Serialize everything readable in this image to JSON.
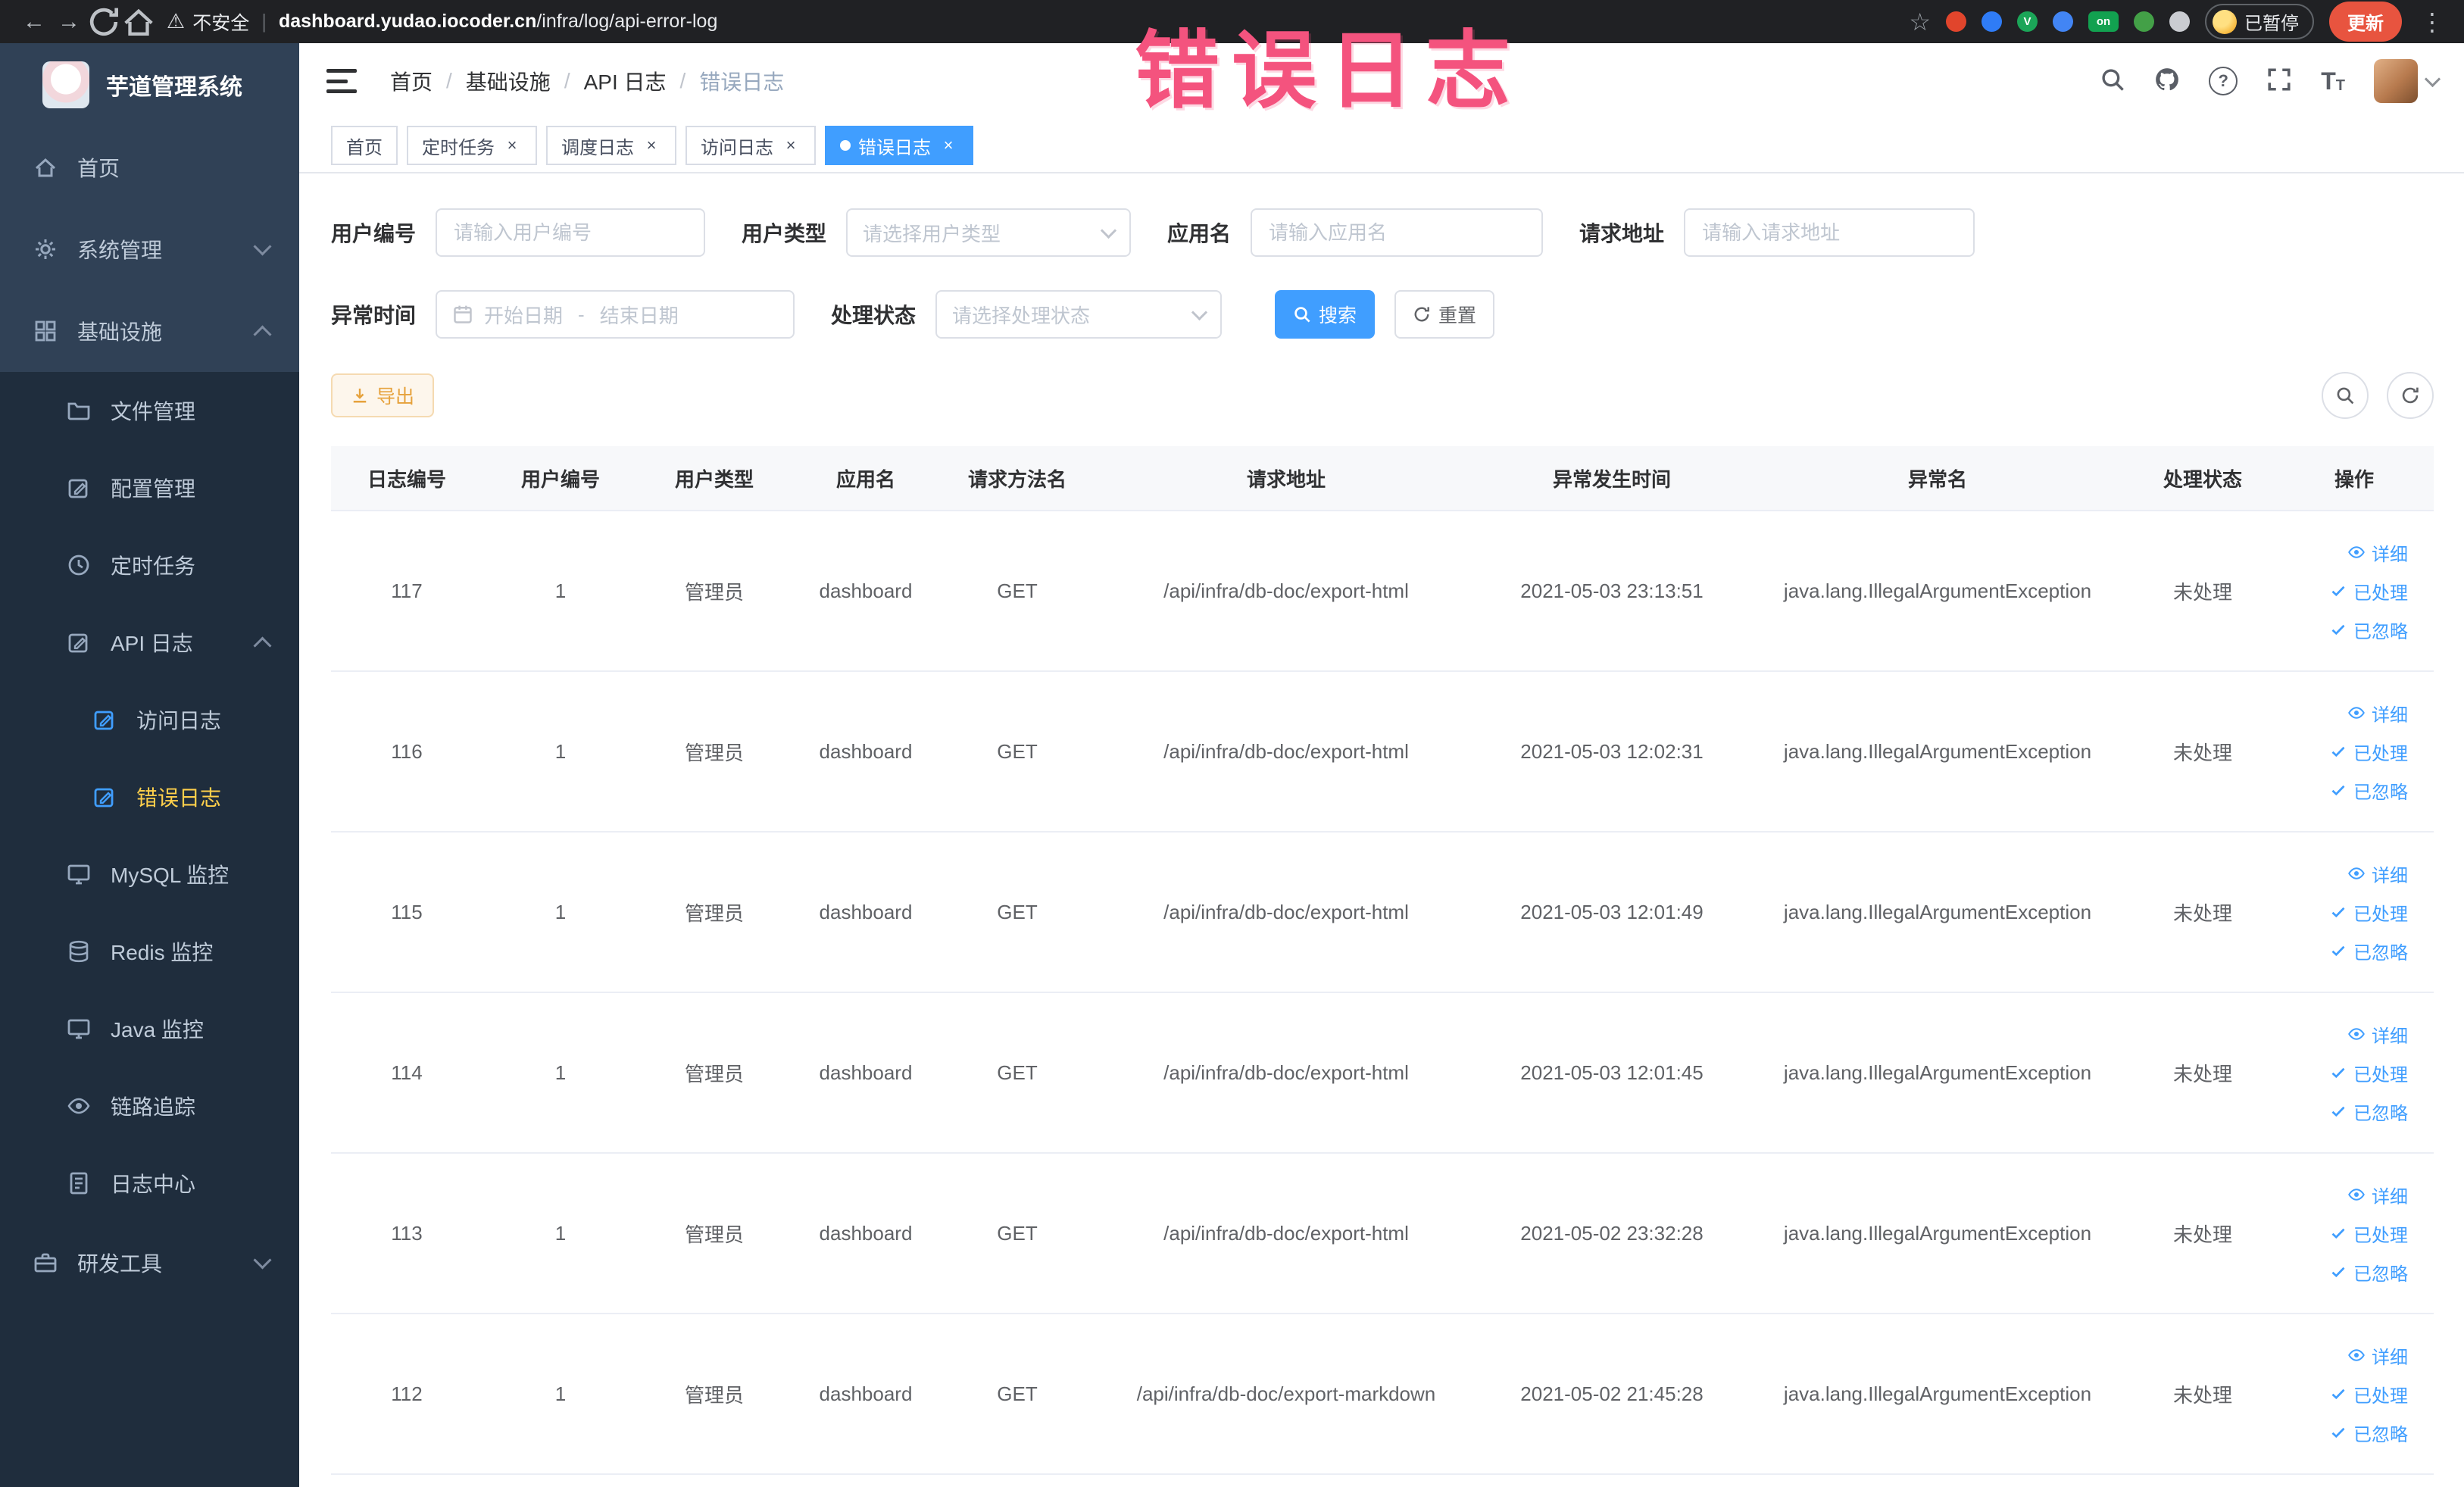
{
  "watermark": {
    "text": "错误日志"
  },
  "colors": {
    "primary": "#409eff",
    "sidebar_bg": "#304156",
    "sidebar_sub_bg": "#1f2d3d",
    "sidebar_active_text": "#ffd04b",
    "watermark_text": "#f4537e",
    "warning_button_text": "#e6a23c",
    "update_button_bg": "#e8543f"
  },
  "browser": {
    "security_label": "不安全",
    "url_domain": "dashboard.yudao.iocoder.cn",
    "url_path": "/infra/log/api-error-log",
    "paused_label": "已暂停",
    "update_label": "更新",
    "extensions": [
      {
        "name": "extension-red-dot",
        "color": "#e1452c",
        "label": ""
      },
      {
        "name": "extension-blue-dot",
        "color": "#2f7cf6",
        "label": ""
      },
      {
        "name": "extension-green-v",
        "color": "#1ba558",
        "label": "V"
      },
      {
        "name": "extension-blue-grid",
        "color": "#4285f4",
        "label": ""
      },
      {
        "name": "extension-on-badge",
        "color": "#12a150",
        "label": "on"
      },
      {
        "name": "extension-green-leaf",
        "color": "#43a047",
        "label": ""
      },
      {
        "name": "extension-gray-paw",
        "color": "#caccd1",
        "label": ""
      }
    ]
  },
  "sidebar": {
    "logo_title": "芋道管理系统",
    "home_label": "首页",
    "system_label": "系统管理",
    "infra_label": "基础设施",
    "file_label": "文件管理",
    "config_label": "配置管理",
    "job_label": "定时任务",
    "api_log_label": "API 日志",
    "access_log_label": "访问日志",
    "error_log_label": "错误日志",
    "mysql_label": "MySQL 监控",
    "redis_label": "Redis 监控",
    "java_label": "Java 监控",
    "trace_label": "链路追踪",
    "log_center_label": "日志中心",
    "dev_label": "研发工具"
  },
  "header": {
    "breadcrumb": [
      "首页",
      "基础设施",
      "API 日志",
      "错误日志"
    ]
  },
  "tabs": [
    {
      "label": "首页",
      "closable": false,
      "active": false
    },
    {
      "label": "定时任务",
      "closable": true,
      "active": false
    },
    {
      "label": "调度日志",
      "closable": true,
      "active": false
    },
    {
      "label": "访问日志",
      "closable": true,
      "active": false
    },
    {
      "label": "错误日志",
      "closable": true,
      "active": true
    }
  ],
  "filters": {
    "user_id_label": "用户编号",
    "user_id_placeholder": "请输入用户编号",
    "user_type_label": "用户类型",
    "user_type_placeholder": "请选择用户类型",
    "app_name_label": "应用名",
    "app_name_placeholder": "请输入应用名",
    "request_url_label": "请求地址",
    "request_url_placeholder": "请输入请求地址",
    "time_label": "异常时间",
    "time_start_placeholder": "开始日期",
    "time_separator": "-",
    "time_end_placeholder": "结束日期",
    "status_label": "处理状态",
    "status_placeholder": "请选择处理状态",
    "search_label": "搜索",
    "reset_label": "重置"
  },
  "toolbar": {
    "export_label": "导出"
  },
  "table": {
    "columns": [
      "日志编号",
      "用户编号",
      "用户类型",
      "应用名",
      "请求方法名",
      "请求地址",
      "异常发生时间",
      "异常名",
      "处理状态",
      "操作"
    ],
    "action_labels": {
      "detail": "详细",
      "processed": "已处理",
      "ignored": "已忽略"
    },
    "rows": [
      {
        "log_id": "117",
        "user_id": "1",
        "user_type": "管理员",
        "app_name": "dashboard",
        "method": "GET",
        "request_url": "/api/infra/db-doc/export-html",
        "time": "2021-05-03 23:13:51",
        "exception_name": "java.lang.IllegalArgumentException",
        "status": "未处理"
      },
      {
        "log_id": "116",
        "user_id": "1",
        "user_type": "管理员",
        "app_name": "dashboard",
        "method": "GET",
        "request_url": "/api/infra/db-doc/export-html",
        "time": "2021-05-03 12:02:31",
        "exception_name": "java.lang.IllegalArgumentException",
        "status": "未处理"
      },
      {
        "log_id": "115",
        "user_id": "1",
        "user_type": "管理员",
        "app_name": "dashboard",
        "method": "GET",
        "request_url": "/api/infra/db-doc/export-html",
        "time": "2021-05-03 12:01:49",
        "exception_name": "java.lang.IllegalArgumentException",
        "status": "未处理"
      },
      {
        "log_id": "114",
        "user_id": "1",
        "user_type": "管理员",
        "app_name": "dashboard",
        "method": "GET",
        "request_url": "/api/infra/db-doc/export-html",
        "time": "2021-05-03 12:01:45",
        "exception_name": "java.lang.IllegalArgumentException",
        "status": "未处理"
      },
      {
        "log_id": "113",
        "user_id": "1",
        "user_type": "管理员",
        "app_name": "dashboard",
        "method": "GET",
        "request_url": "/api/infra/db-doc/export-html",
        "time": "2021-05-02 23:32:28",
        "exception_name": "java.lang.IllegalArgumentException",
        "status": "未处理"
      },
      {
        "log_id": "112",
        "user_id": "1",
        "user_type": "管理员",
        "app_name": "dashboard",
        "method": "GET",
        "request_url": "/api/infra/db-doc/export-markdown",
        "time": "2021-05-02 21:45:28",
        "exception_name": "java.lang.IllegalArgumentException",
        "status": "未处理"
      }
    ]
  }
}
